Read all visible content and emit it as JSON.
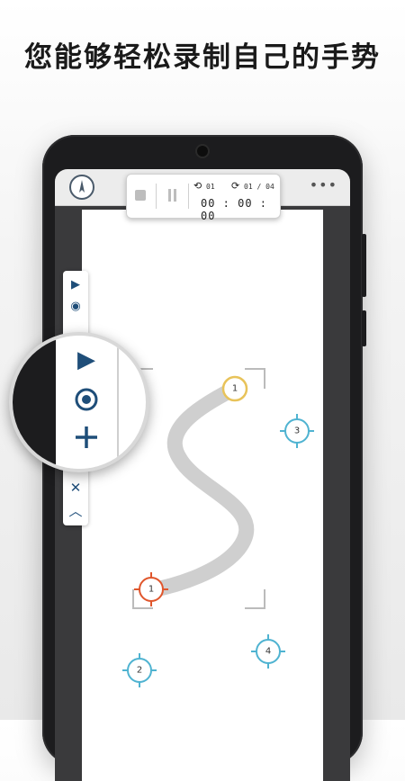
{
  "headline": "您能够轻松录制自己的手势",
  "recorder": {
    "loop_count": "01",
    "repeat_count": "01 / 04",
    "timer": "00 : 00 : 00"
  },
  "side_toolbar": {
    "items": [
      "play-icon",
      "target-icon",
      "add-icon",
      "target-icon",
      "close-icon",
      "chevron-up-icon"
    ]
  },
  "targets": {
    "start": "1",
    "end": "1",
    "second": "2",
    "third": "3",
    "fourth": "4"
  },
  "colors": {
    "accent": "#1f4e79",
    "start_target": "#e8c35a",
    "end_target": "#e0562c",
    "cyan_target": "#4fb3d1",
    "gesture_path": "#cfcfcf"
  }
}
